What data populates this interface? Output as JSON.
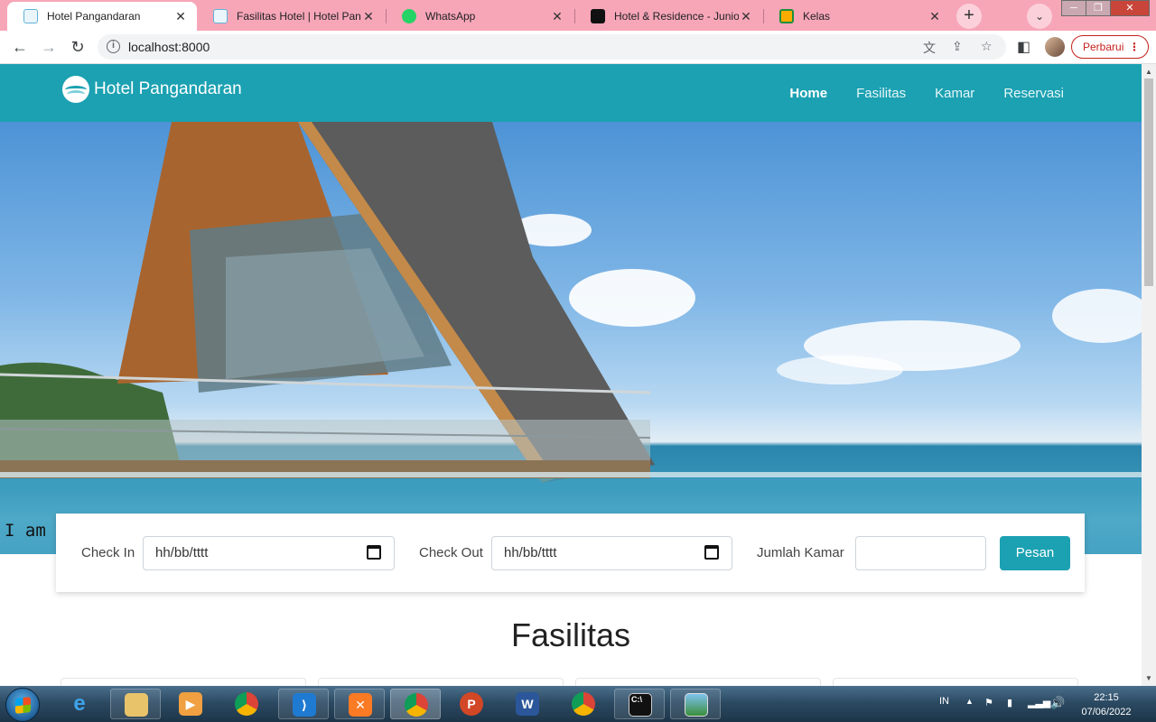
{
  "browser": {
    "tabs": [
      {
        "title": "Hotel Pangandaran",
        "active": true,
        "favicon": "hotel-wave-icon"
      },
      {
        "title": "Fasilitas Hotel | Hotel Panga",
        "active": false,
        "favicon": "hotel-wave-icon"
      },
      {
        "title": "WhatsApp",
        "active": false,
        "favicon": "whatsapp-icon"
      },
      {
        "title": "Hotel & Residence - Junior",
        "active": false,
        "favicon": "black-square-icon"
      },
      {
        "title": "Kelas",
        "active": false,
        "favicon": "classroom-icon"
      }
    ],
    "new_tab": "+",
    "url": "localhost:8000",
    "update_label": "Perbarui"
  },
  "site": {
    "brand": "Hotel Pangandaran",
    "menu": [
      "Home",
      "Fasilitas",
      "Kamar",
      "Reservasi"
    ],
    "hero_caption": "I am S",
    "booking": {
      "checkin_label": "Check In",
      "checkin_placeholder": "hh/bb/tttt",
      "checkout_label": "Check Out",
      "checkout_placeholder": "hh/bb/tttt",
      "rooms_label": "Jumlah Kamar",
      "rooms_value": "",
      "submit_label": "Pesan"
    },
    "section_title": "Fasilitas"
  },
  "taskbar": {
    "apps": [
      "internet-explorer",
      "file-explorer",
      "media-player",
      "chrome",
      "vscode",
      "xampp",
      "chrome-active",
      "powerpoint",
      "word",
      "chrome-profile",
      "command-prompt",
      "photo-viewer"
    ],
    "lang": "IN",
    "time": "22:15",
    "date": "07/06/2022"
  },
  "colors": {
    "accent": "#1ba1b2",
    "tabstrip": "#f7a6b8",
    "update": "#c5221f"
  }
}
